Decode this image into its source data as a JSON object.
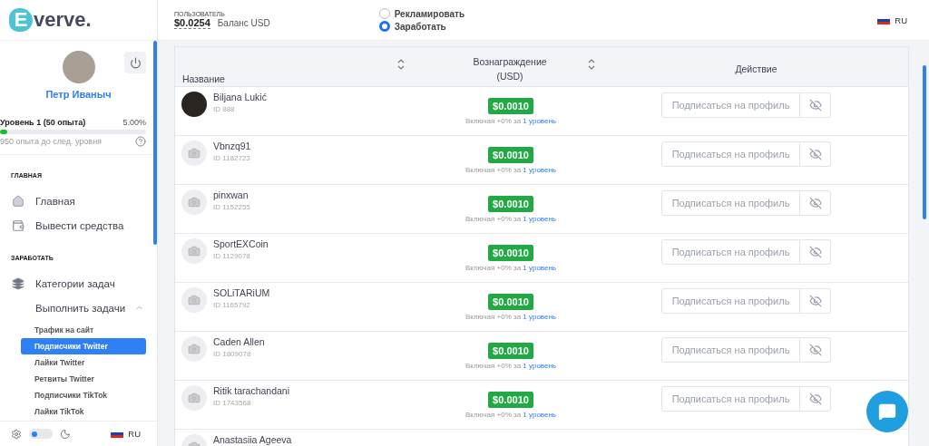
{
  "sidebar": {
    "logo": {
      "mark": "E",
      "text": "verve."
    },
    "user": {
      "name": "Петр Иваныч",
      "level_label": "Уровень 1 (50 опыта)",
      "level_percent": "5.00%",
      "level": 0.05,
      "hint": "950 опыта до след. уровня"
    },
    "sections": [
      {
        "title": "ГЛАВНАЯ",
        "items": [
          {
            "label": "Главная"
          },
          {
            "label": "Вывести средства"
          }
        ]
      },
      {
        "title": "ЗАРАБОТАТЬ",
        "items": [
          {
            "label": "Категории задач"
          },
          {
            "label": "Выполнить задачи",
            "expanded": true,
            "children": [
              {
                "label": "Трафик на сайт",
                "selected": false
              },
              {
                "label": "Подписчики Twitter",
                "selected": true
              },
              {
                "label": "Лайки Twitter",
                "selected": false
              },
              {
                "label": "Ретвиты Twitter",
                "selected": false
              },
              {
                "label": "Подписчики TikTok",
                "selected": false
              },
              {
                "label": "Лайки TikTok",
                "selected": false
              }
            ]
          }
        ]
      }
    ],
    "footer": {
      "dark_mode": false,
      "language": "RU"
    }
  },
  "header": {
    "balance_caption": "ПОЛЬЗОВАТЕЛЬ",
    "balance": "$0.0254",
    "balance_label": "Баланс USD",
    "modes": [
      {
        "label": "Рекламировать",
        "selected": false
      },
      {
        "label": "Заработать",
        "selected": true
      }
    ],
    "language": "RU"
  },
  "table": {
    "columns": [
      {
        "label": "Название",
        "sortable": true
      },
      {
        "label": "Вознаграждение (USD)",
        "sortable": true
      },
      {
        "label": "Действие",
        "sortable": false
      }
    ],
    "rows": [
      {
        "name": "Biljana Lukić",
        "id": "ID 888",
        "kind": "photo",
        "reward": "$0.0010",
        "note": "Включая +0% за",
        "note_link": "1 уровень",
        "action": "Подписаться на профиль"
      },
      {
        "name": "Vbnzq91",
        "id": "ID 1182723",
        "kind": "placeholder",
        "reward": "$0.0010",
        "note": "Включая +0% за",
        "note_link": "1 уровень",
        "action": "Подписаться на профиль"
      },
      {
        "name": "pinxwan",
        "id": "ID 1152255",
        "kind": "placeholder",
        "reward": "$0.0010",
        "note": "Включая +0% за",
        "note_link": "1 уровень",
        "action": "Подписаться на профиль"
      },
      {
        "name": "SportEXCoin",
        "id": "ID 1129078",
        "kind": "placeholder",
        "reward": "$0.0010",
        "note": "Включая +0% за",
        "note_link": "1 уровень",
        "action": "Подписаться на профиль"
      },
      {
        "name": "SOLiTARiUM",
        "id": "ID 1165792",
        "kind": "placeholder",
        "reward": "$0.0010",
        "note": "Включая +0% за",
        "note_link": "1 уровень",
        "action": "Подписаться на профиль"
      },
      {
        "name": "Caden Allen",
        "id": "ID 1809078",
        "kind": "placeholder",
        "reward": "$0.0010",
        "note": "Включая +0% за",
        "note_link": "1 уровень",
        "action": "Подписаться на профиль"
      },
      {
        "name": "Ritik tarachandani",
        "id": "ID 1743568",
        "kind": "placeholder",
        "reward": "$0.0010",
        "note": "Включая +0% за",
        "note_link": "1 уровень",
        "action": "Подписаться на профиль"
      },
      {
        "name": "Anastasiia Ageeva",
        "kind": "placeholder"
      }
    ]
  }
}
